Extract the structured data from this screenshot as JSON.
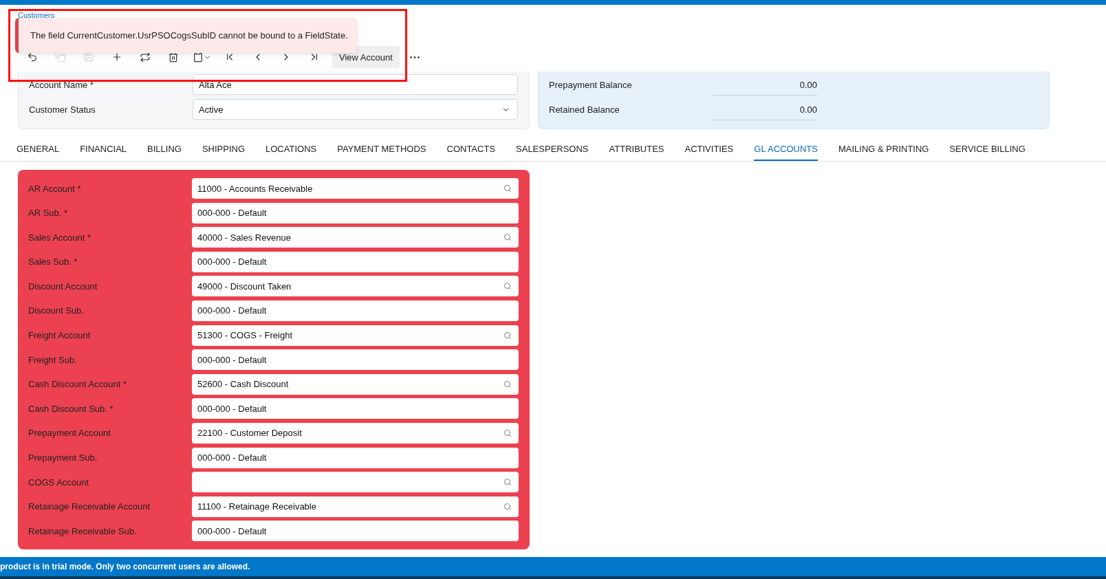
{
  "breadcrumb": "Customers",
  "toast": {
    "message": "The field CurrentCustomer.UsrPSOCogsSubID cannot be bound to a FieldState."
  },
  "toolbar": {
    "buttons": [
      {
        "kind": "undo",
        "disabled": false
      },
      {
        "kind": "copy",
        "disabled": true
      },
      {
        "kind": "save",
        "disabled": true
      },
      {
        "kind": "add",
        "disabled": false
      },
      {
        "kind": "swap",
        "disabled": false
      },
      {
        "kind": "delete",
        "disabled": false
      },
      {
        "kind": "clipboard",
        "disabled": false
      },
      {
        "kind": "first",
        "disabled": false
      },
      {
        "kind": "prev",
        "disabled": false
      },
      {
        "kind": "next",
        "disabled": false
      },
      {
        "kind": "last",
        "disabled": false
      }
    ],
    "view_button": "View Account"
  },
  "header": {
    "fields": [
      {
        "label": "Account Name *",
        "value": "Alta Ace",
        "kind": "text"
      },
      {
        "label": "Customer Status",
        "value": "Active",
        "kind": "select"
      }
    ],
    "balances": [
      {
        "label": "Prepayment Balance",
        "value": "0.00"
      },
      {
        "label": "Retained Balance",
        "value": "0.00"
      }
    ]
  },
  "tabs": [
    {
      "label": "GENERAL",
      "selected": false
    },
    {
      "label": "FINANCIAL",
      "selected": false
    },
    {
      "label": "BILLING",
      "selected": false
    },
    {
      "label": "SHIPPING",
      "selected": false
    },
    {
      "label": "LOCATIONS",
      "selected": false
    },
    {
      "label": "PAYMENT METHODS",
      "selected": false
    },
    {
      "label": "CONTACTS",
      "selected": false
    },
    {
      "label": "SALESPERSONS",
      "selected": false
    },
    {
      "label": "ATTRIBUTES",
      "selected": false
    },
    {
      "label": "ACTIVITIES",
      "selected": false
    },
    {
      "label": "GL ACCOUNTS",
      "selected": true
    },
    {
      "label": "MAILING & PRINTING",
      "selected": false
    },
    {
      "label": "SERVICE BILLING",
      "selected": false
    }
  ],
  "gl_fields": [
    {
      "label": "AR Account *",
      "value": "11000 - Accounts Receivable",
      "kind": "lookup"
    },
    {
      "label": "AR Sub. *",
      "value": "000-000 - Default",
      "kind": "text"
    },
    {
      "label": "Sales Account *",
      "value": "40000 - Sales Revenue",
      "kind": "lookup"
    },
    {
      "label": "Sales Sub. *",
      "value": "000-000 - Default",
      "kind": "text"
    },
    {
      "label": "Discount Account",
      "value": "49000 - Discount Taken",
      "kind": "lookup"
    },
    {
      "label": "Discount Sub.",
      "value": "000-000 - Default",
      "kind": "text"
    },
    {
      "label": "Freight Account",
      "value": "51300 - COGS - Freight",
      "kind": "lookup"
    },
    {
      "label": "Freight Sub.",
      "value": "000-000 - Default",
      "kind": "text"
    },
    {
      "label": "Cash Discount Account *",
      "value": "52600 - Cash Discount",
      "kind": "lookup"
    },
    {
      "label": "Cash Discount Sub. *",
      "value": "000-000 - Default",
      "kind": "text"
    },
    {
      "label": "Prepayment Account",
      "value": "22100 - Customer Deposit",
      "kind": "lookup"
    },
    {
      "label": "Prepayment Sub.",
      "value": "000-000 - Default",
      "kind": "text"
    },
    {
      "label": "COGS Account",
      "kind": "lookup"
    },
    {
      "label": "Retainage Receivable Account",
      "value": "11100 - Retainage Receivable",
      "kind": "lookup"
    },
    {
      "label": "Retainage Receivable Sub.",
      "value": "000-000 - Default",
      "kind": "text"
    }
  ],
  "status_bar": "product is in trial mode. Only two concurrent users are allowed."
}
